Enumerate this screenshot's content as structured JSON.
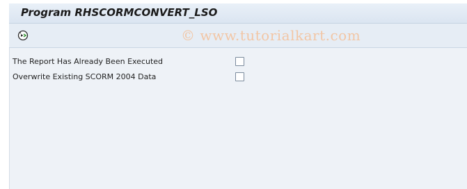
{
  "window": {
    "title": "Program RHSCORMCONVERT_LSO"
  },
  "toolbar": {
    "execute_icon": "execute-icon",
    "watermark": "© www.tutorialkart.com"
  },
  "parameters": [
    {
      "label": "The Report Has Already Been Executed",
      "checked": false
    },
    {
      "label": "Overwrite Existing SCORM 2004 Data",
      "checked": false
    }
  ],
  "colors": {
    "title_bar": "#dbe5f1",
    "toolbar": "#e6edf5",
    "content": "#eef2f7",
    "watermark": "#f2c6a5"
  }
}
